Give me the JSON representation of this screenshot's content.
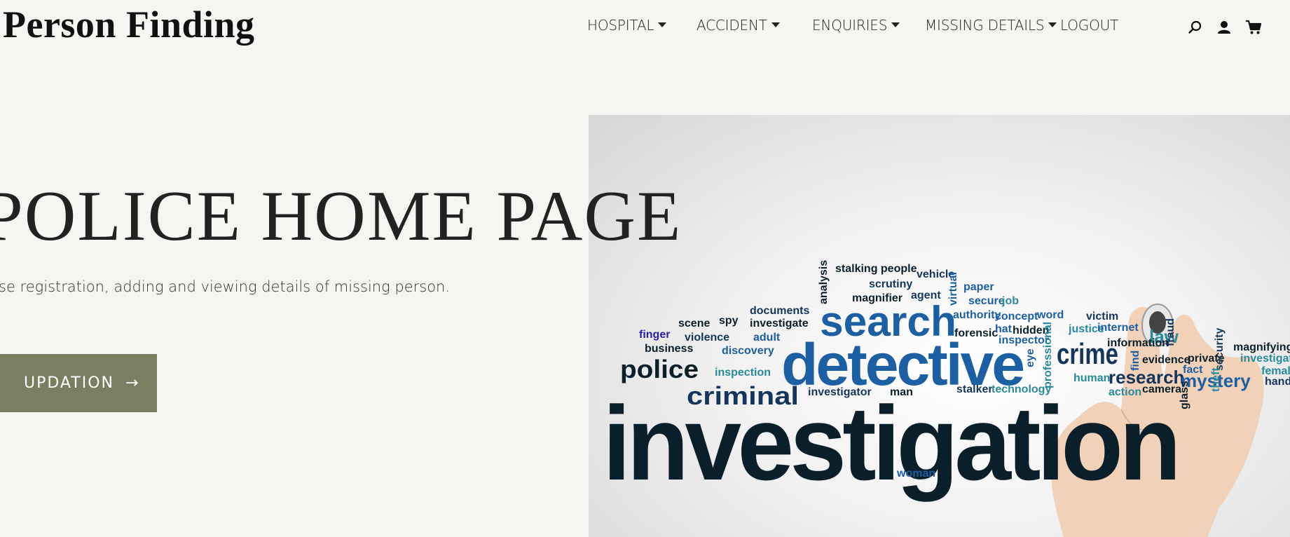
{
  "brand": {
    "logo_text": "Person Finding"
  },
  "nav": {
    "items": [
      {
        "label": "HOSPITAL",
        "dropdown": true
      },
      {
        "label": "ACCIDENT",
        "dropdown": true
      },
      {
        "label": "ENQUIRIES",
        "dropdown": true
      },
      {
        "label": "MISSING DETAILS",
        "dropdown": true
      },
      {
        "label": "LOGOUT",
        "dropdown": false
      }
    ],
    "icons": [
      "search-icon",
      "user-icon",
      "cart-icon"
    ]
  },
  "hero": {
    "title": "POLICE HOME PAGE",
    "subtitle": "se registration, adding and viewing details of missing person.",
    "cta_label": "UPDATION",
    "cta_arrow": "→"
  },
  "image": {
    "words": [
      "investigation",
      "detective",
      "search",
      "crime",
      "criminal",
      "police",
      "research",
      "mystery",
      "law",
      "documents",
      "investigate",
      "discovery",
      "inspection",
      "investigator",
      "stalker",
      "technology",
      "man",
      "woman",
      "finger",
      "business",
      "violence",
      "scene",
      "spy",
      "adult",
      "magnifier",
      "agent",
      "scrutiny",
      "stalking people",
      "vehicle",
      "paper",
      "secure",
      "job",
      "authority",
      "concept",
      "word",
      "forensic",
      "hat",
      "hidden",
      "inspector",
      "justice",
      "internet",
      "victim",
      "information",
      "evidence",
      "private",
      "fact",
      "human",
      "action",
      "camera",
      "analysis",
      "virtual",
      "professional",
      "eye",
      "security",
      "magnifying",
      "investigating",
      "female",
      "hand",
      "theft",
      "glass",
      "find",
      "fraud"
    ],
    "colors": {
      "dark": "#0b1f2a",
      "blue": "#1d5fa3",
      "teal": "#2a8a9c",
      "navy": "#16355b"
    }
  },
  "colors": {
    "background": "#f6f5f2",
    "button": "#7a7f62",
    "text": "#222222"
  }
}
